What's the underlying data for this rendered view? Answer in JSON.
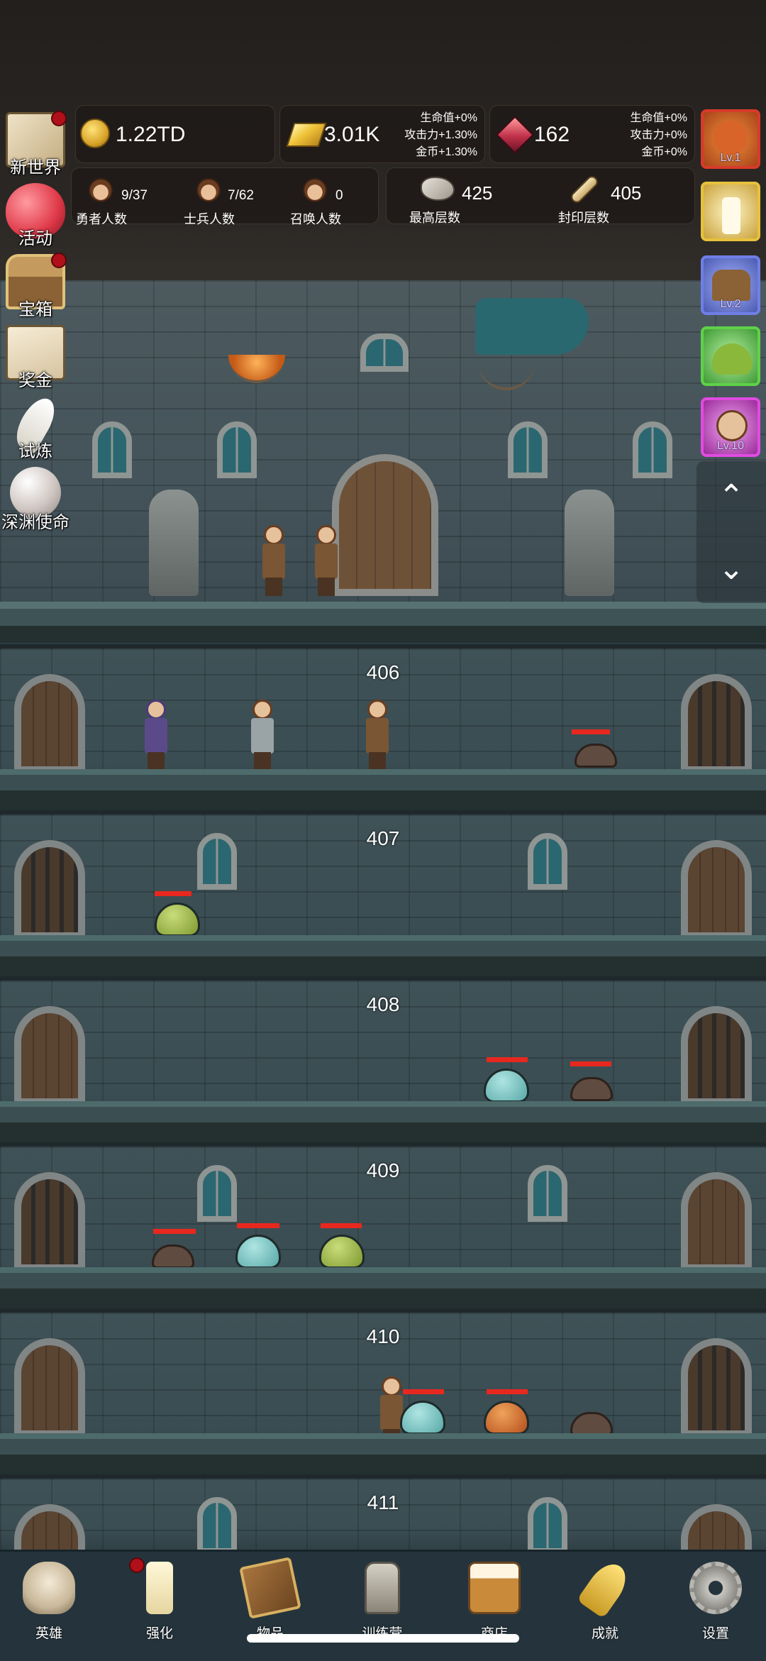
{
  "resources": {
    "coins": "1.22TD",
    "gold_bars": "3.01K",
    "gold_bonus": [
      "生命值+0%",
      "攻击力+1.30%",
      "金币+1.30%"
    ],
    "gems": "162",
    "gem_bonus": [
      "生命值+0%",
      "攻击力+0%",
      "金币+0%"
    ]
  },
  "counters": {
    "heroes": {
      "value": "9/37",
      "label": "勇者人数"
    },
    "soldiers": {
      "value": "7/62",
      "label": "士兵人数"
    },
    "summons": {
      "value": "0",
      "label": "召唤人数"
    },
    "highest_floor": {
      "value": "425",
      "label": "最高层数"
    },
    "sealed_floor": {
      "value": "405",
      "label": "封印层数"
    }
  },
  "left_menu": [
    {
      "label": "新世界",
      "icon": "map-icon",
      "badge": true
    },
    {
      "label": "活动",
      "icon": "heart-icon",
      "badge": false
    },
    {
      "label": "宝箱",
      "icon": "chest-icon",
      "badge": true
    },
    {
      "label": "奖金",
      "icon": "envelope-icon",
      "badge": false
    },
    {
      "label": "试炼",
      "icon": "feather-icon",
      "badge": false
    },
    {
      "label": "深渊使命",
      "icon": "pearl-icon",
      "badge": false
    }
  ],
  "right_boosts": [
    {
      "icon": "pumpkin-icon",
      "level": "Lv.1",
      "border": "#d83a2a"
    },
    {
      "icon": "candle-icon",
      "level": "",
      "border": "#e6c13c"
    },
    {
      "icon": "chest-boost-icon",
      "level": "Lv.2",
      "border": "#6f7fe6"
    },
    {
      "icon": "slime-boost-icon",
      "level": "",
      "border": "#5fd14a"
    },
    {
      "icon": "hero-boost-icon",
      "level": "Lv.10",
      "border": "#e04be0"
    }
  ],
  "floors": [
    "406",
    "407",
    "408",
    "409",
    "410",
    "411"
  ],
  "nav": [
    {
      "label": "英雄",
      "icon": "skull-icon"
    },
    {
      "label": "强化",
      "icon": "candle-icon"
    },
    {
      "label": "物品",
      "icon": "book-icon"
    },
    {
      "label": "训练营",
      "icon": "lantern-icon"
    },
    {
      "label": "商店",
      "icon": "beer-mug-icon"
    },
    {
      "label": "成就",
      "icon": "key-icon"
    },
    {
      "label": "设置",
      "icon": "gear-icon"
    }
  ],
  "colors": {
    "hp_bar": "#e8281e",
    "badge": "#b0101a",
    "nav_bg": "#25343c"
  }
}
